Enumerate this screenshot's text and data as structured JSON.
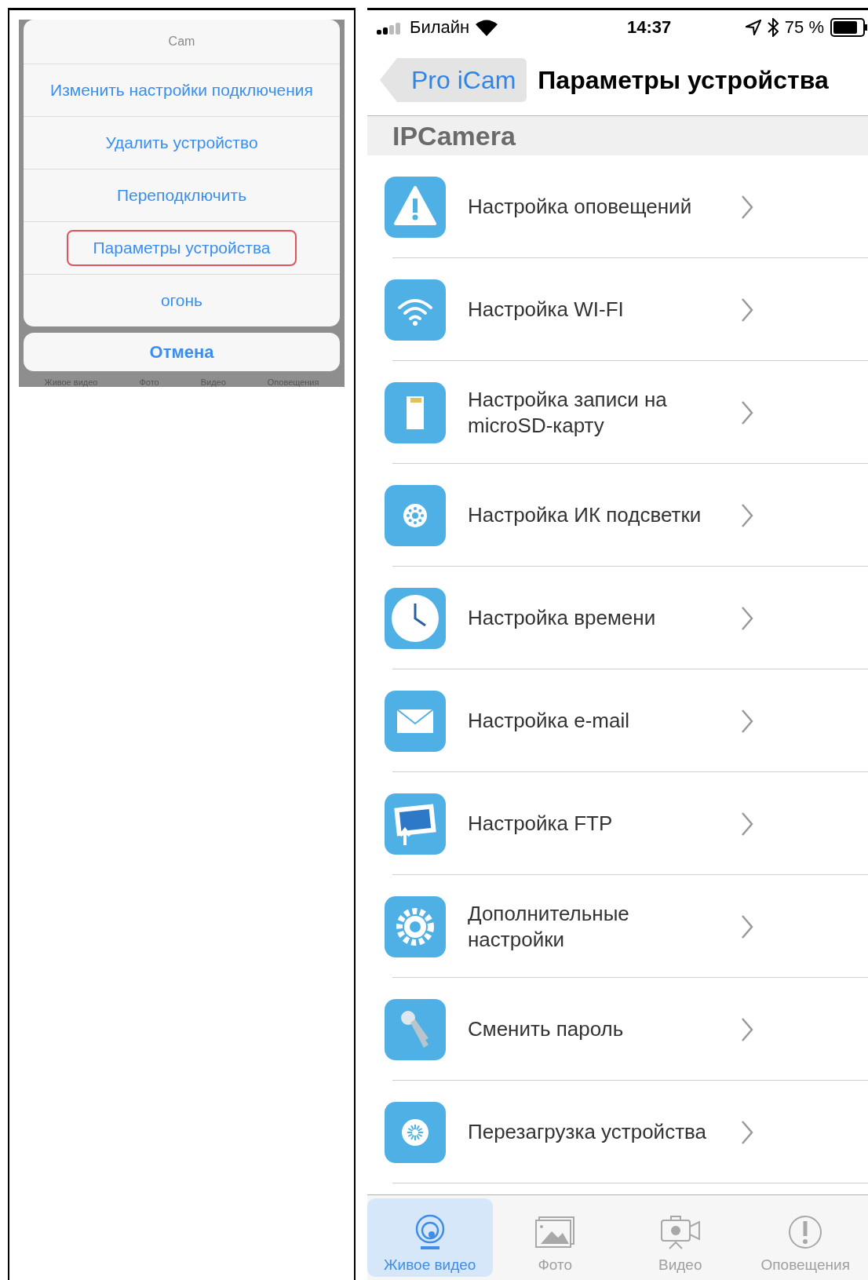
{
  "left_screen": {
    "action_sheet": {
      "title": "Cam",
      "items": [
        {
          "label": "Изменить настройки подключения",
          "highlighted": false
        },
        {
          "label": "Удалить устройство",
          "highlighted": false
        },
        {
          "label": "Переподключить",
          "highlighted": false
        },
        {
          "label": "Параметры устройства",
          "highlighted": true
        },
        {
          "label": "огонь",
          "highlighted": false
        }
      ],
      "cancel": "Отмена"
    },
    "background_tabs": [
      "Живое видео",
      "Фото",
      "Видео",
      "Оповещения"
    ]
  },
  "right_screen": {
    "status_bar": {
      "carrier": "Билайн",
      "time": "14:37",
      "battery": "75 %"
    },
    "nav_bar": {
      "back": "Pro iCam",
      "title": "Параметры устройства"
    },
    "section": "IPCamera",
    "rows": [
      {
        "kind": "warning",
        "label": "Настройка оповещений"
      },
      {
        "kind": "wifi",
        "label": "Настройка WI-FI"
      },
      {
        "kind": "sdcard",
        "label": "Настройка записи на microSD-карту"
      },
      {
        "kind": "ir",
        "label": "Настройка ИК подсветки"
      },
      {
        "kind": "clock",
        "label": "Настройка времени"
      },
      {
        "kind": "mail",
        "label": "Настройка e-mail"
      },
      {
        "kind": "ftp",
        "label": "Настройка FTP"
      },
      {
        "kind": "gear",
        "label": "Дополнительные настройки"
      },
      {
        "kind": "key",
        "label": "Сменить пароль"
      },
      {
        "kind": "reload",
        "label": "Перезагрузка устройства"
      }
    ],
    "tabs": [
      {
        "kind": "live",
        "label": "Живое видео",
        "selected": true
      },
      {
        "kind": "photo",
        "label": "Фото",
        "selected": false
      },
      {
        "kind": "video",
        "label": "Видео",
        "selected": false
      },
      {
        "kind": "alert",
        "label": "Оповещения",
        "selected": false
      }
    ]
  }
}
